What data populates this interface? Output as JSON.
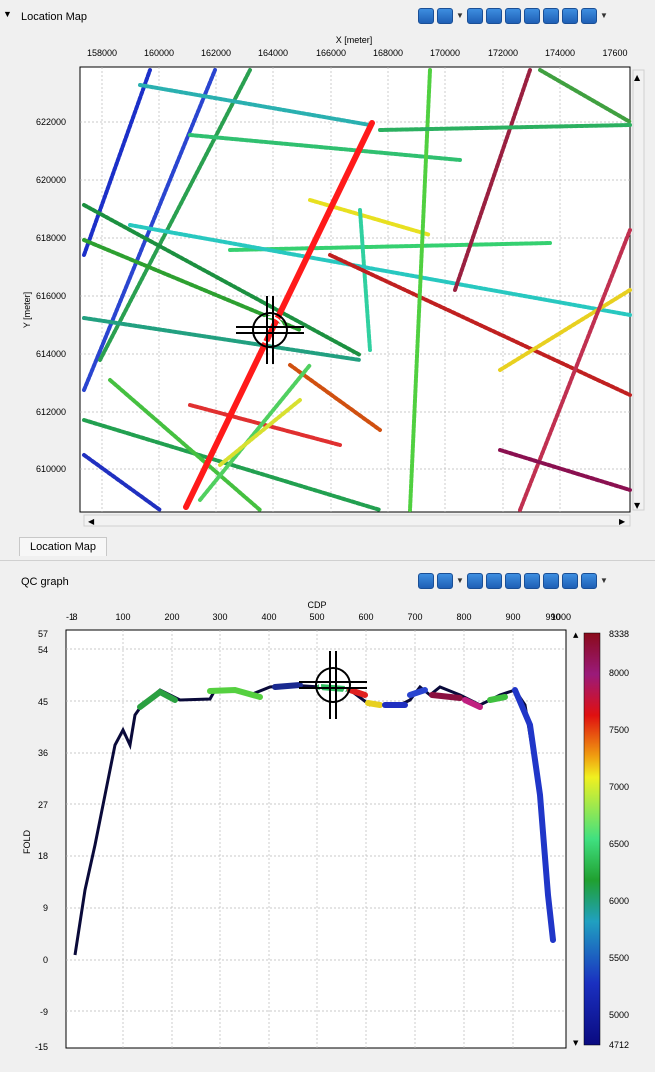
{
  "map_panel": {
    "title": "Location Map",
    "tab_label": "Location Map",
    "x_axis_label": "X [meter]",
    "y_axis_label": "Y [meter]",
    "x_ticks": [
      "158000",
      "160000",
      "162000",
      "164000",
      "166000",
      "168000",
      "170000",
      "172000",
      "174000",
      "17600"
    ],
    "y_ticks": [
      "622000",
      "620000",
      "618000",
      "616000",
      "614000",
      "612000",
      "610000"
    ],
    "toolbar_icons": [
      "settings-icon",
      "layout-icon",
      "zoom-icon",
      "pan-icon",
      "pointer-icon",
      "display-icon",
      "export-icon",
      "pen-icon",
      "compass-icon"
    ]
  },
  "qc_panel": {
    "title": "QC graph",
    "x_axis_label": "CDP",
    "y_axis_label": "FOLD",
    "x_ticks": [
      "-1",
      "8",
      "100",
      "200",
      "300",
      "400",
      "500",
      "600",
      "700",
      "800",
      "900",
      "990",
      "1000"
    ],
    "y_ticks": [
      "57",
      "54",
      "45",
      "36",
      "27",
      "18",
      "9",
      "0",
      "-9",
      "-15"
    ],
    "colorbar_ticks": [
      "8338",
      "8000",
      "7500",
      "7000",
      "6500",
      "6000",
      "5500",
      "5000",
      "4712"
    ],
    "toolbar_icons": [
      "settings-icon",
      "layout-icon",
      "zoom-icon",
      "pan-icon",
      "pointer-icon",
      "display-icon",
      "export-icon",
      "pen-icon",
      "compass-icon"
    ]
  },
  "colors": {
    "selected_line": "#ff1a1a",
    "grid": "#c8c8c8",
    "accent": "#2a6fd0"
  }
}
